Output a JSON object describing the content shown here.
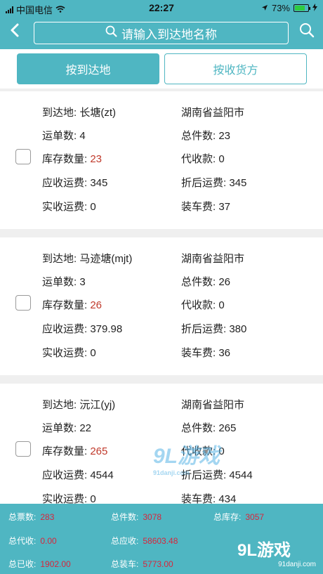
{
  "status": {
    "carrier": "中国电信",
    "time": "22:27",
    "battery": "73%"
  },
  "search": {
    "placeholder": "请输入到达地名称"
  },
  "tabs": [
    {
      "label": "按到达地"
    },
    {
      "label": "按收货方"
    }
  ],
  "cards": [
    {
      "dest_label": "到达地:",
      "dest": "长塘(zt)",
      "region": "湖南省益阳市",
      "waybill_label": "运单数:",
      "waybill": "4",
      "total_pieces_label": "总件数:",
      "total_pieces": "23",
      "stock_label": "库存数量:",
      "stock": "23",
      "cod_label": "代收款:",
      "cod": "0",
      "freight_due_label": "应收运费:",
      "freight_due": "345",
      "discounted_label": "折后运费:",
      "discounted": "345",
      "freight_paid_label": "实收运费:",
      "freight_paid": "0",
      "loading_label": "装车费:",
      "loading": "37"
    },
    {
      "dest_label": "到达地:",
      "dest": "马迹塘(mjt)",
      "region": "湖南省益阳市",
      "waybill_label": "运单数:",
      "waybill": "3",
      "total_pieces_label": "总件数:",
      "total_pieces": "26",
      "stock_label": "库存数量:",
      "stock": "26",
      "cod_label": "代收款:",
      "cod": "0",
      "freight_due_label": "应收运费:",
      "freight_due": "379.98",
      "discounted_label": "折后运费:",
      "discounted": "380",
      "freight_paid_label": "实收运费:",
      "freight_paid": "0",
      "loading_label": "装车费:",
      "loading": "36"
    },
    {
      "dest_label": "到达地:",
      "dest": "沅江(yj)",
      "region": "湖南省益阳市",
      "waybill_label": "运单数:",
      "waybill": "22",
      "total_pieces_label": "总件数:",
      "total_pieces": "265",
      "stock_label": "库存数量:",
      "stock": "265",
      "cod_label": "代收款:",
      "cod": "0",
      "freight_due_label": "应收运费:",
      "freight_due": "4544",
      "discounted_label": "折后运费:",
      "discounted": "4544",
      "freight_paid_label": "实收运费:",
      "freight_paid": "0",
      "loading_label": "装车费:",
      "loading": "434"
    }
  ],
  "summary": {
    "total_tickets_label": "总票数:",
    "total_tickets": "283",
    "total_pieces_label": "总件数:",
    "total_pieces": "3078",
    "total_stock_label": "总库存:",
    "total_stock": "3057",
    "total_cod_label": "总代收:",
    "total_cod": "0.00",
    "total_due_label": "总应收:",
    "total_due": "58603.48",
    "total_received_label": "总已收:",
    "total_received": "1902.00",
    "total_loading_label": "总装车:",
    "total_loading": "5773.00"
  },
  "watermark": {
    "logo_big": "9L游戏",
    "logo_small": "91danji.com",
    "center_big": "9L游戏",
    "center_small": "91danji.com"
  },
  "colors": {
    "accent": "#4fb6c2",
    "highlight": "#c0392b",
    "summary_value": "#d7263d"
  }
}
